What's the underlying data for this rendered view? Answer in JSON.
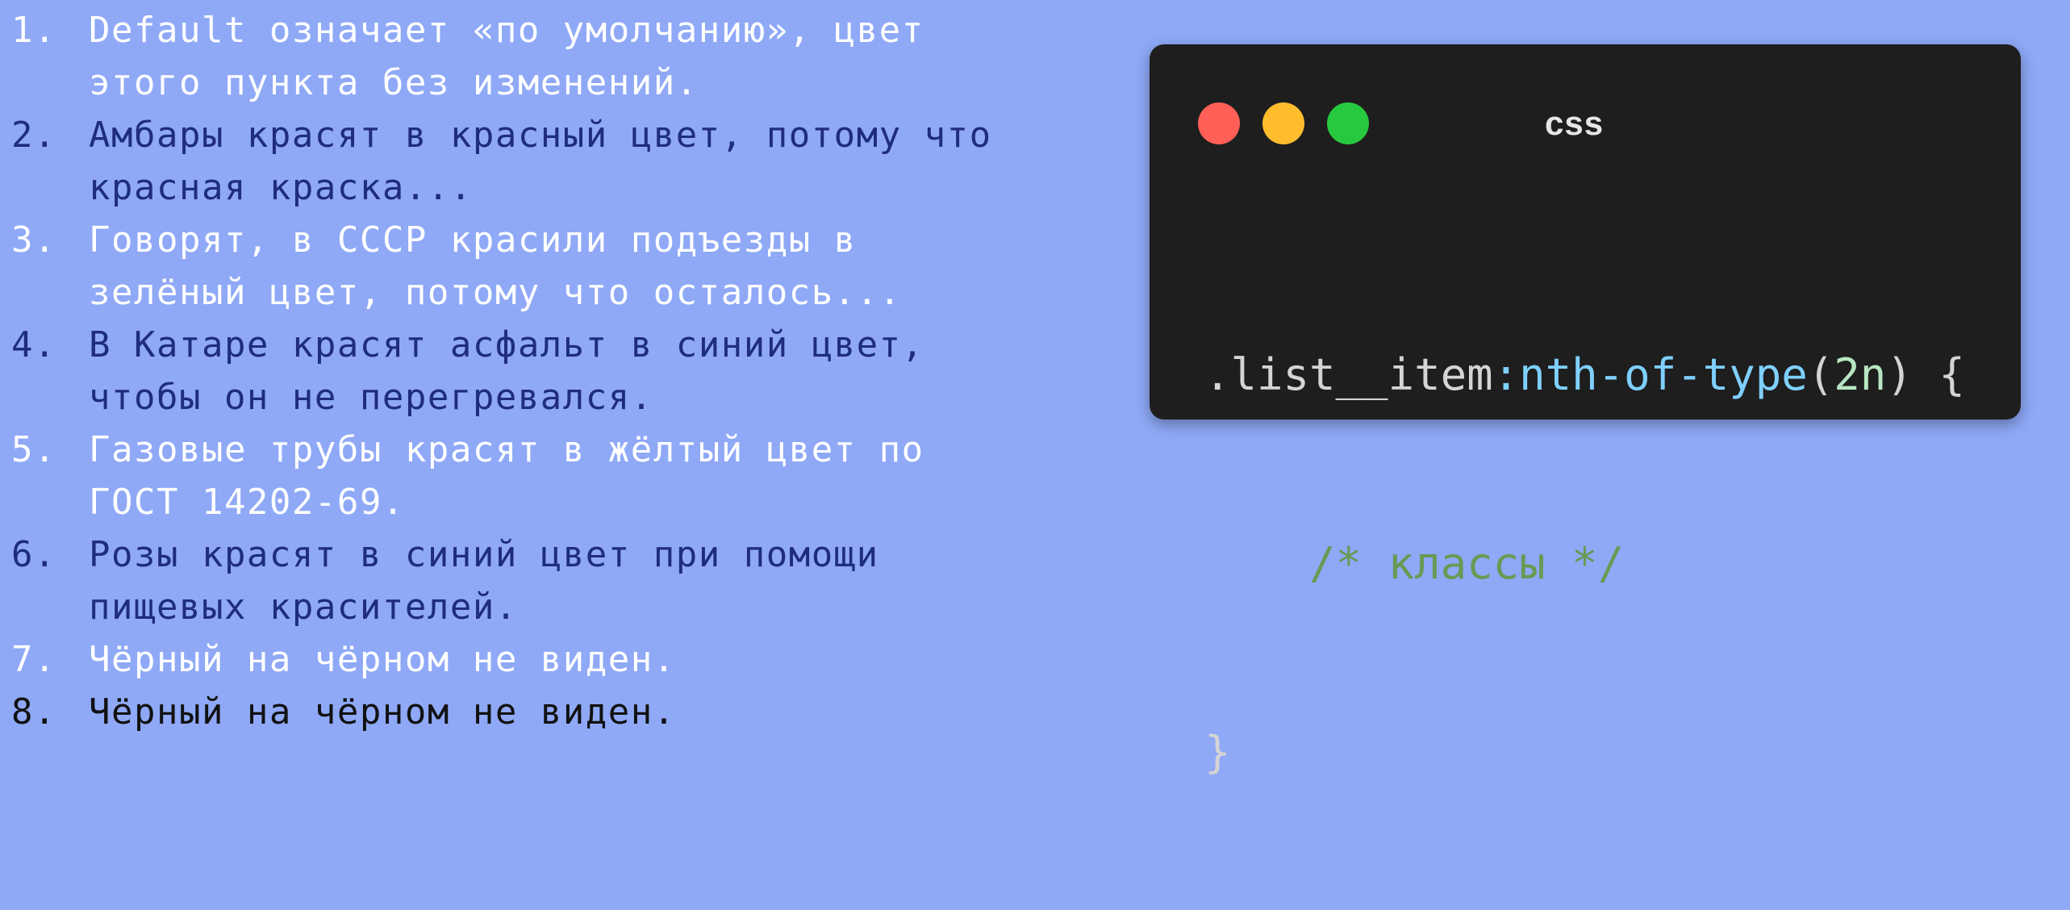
{
  "list": {
    "items": [
      {
        "num": "1.",
        "lines": [
          "Default означает «по умолчанию», цвет",
          "этого пункта без изменений."
        ]
      },
      {
        "num": "2.",
        "lines": [
          "Амбары красят в красный цвет, потому что",
          "красная краска..."
        ]
      },
      {
        "num": "3.",
        "lines": [
          "Говорят, в СССР красили подъезды в",
          "зелёный цвет, потому что осталось..."
        ]
      },
      {
        "num": "4.",
        "lines": [
          "В Катаре красят асфальт в синий цвет,",
          "чтобы он не перегревался."
        ]
      },
      {
        "num": "5.",
        "lines": [
          "Газовые трубы красят в жёлтый цвет по",
          "ГОСТ 14202-69."
        ]
      },
      {
        "num": "6.",
        "lines": [
          "Розы красят в синий цвет при помощи",
          "пищевых красителей."
        ]
      },
      {
        "num": "7.",
        "lines": [
          "Чёрный на чёрном не виден."
        ]
      },
      {
        "num": "8.",
        "lines": [
          "Чёрный на чёрном не виден."
        ]
      }
    ]
  },
  "code_window": {
    "title": "css",
    "dots": [
      {
        "name": "close-dot",
        "color": "#ff5f56"
      },
      {
        "name": "minimize-dot",
        "color": "#ffbd2e"
      },
      {
        "name": "maximize-dot",
        "color": "#27c93f"
      }
    ],
    "code": {
      "selector": ".list__item",
      "pseudo": ":nth-of-type",
      "open_paren": "(",
      "arg": "2n",
      "close_paren": ")",
      "open_brace": " {",
      "comment": "    /* классы */",
      "close_brace": "}"
    }
  },
  "colors": {
    "background": "#8fa9f7",
    "window_bg": "#1e1e1e"
  }
}
